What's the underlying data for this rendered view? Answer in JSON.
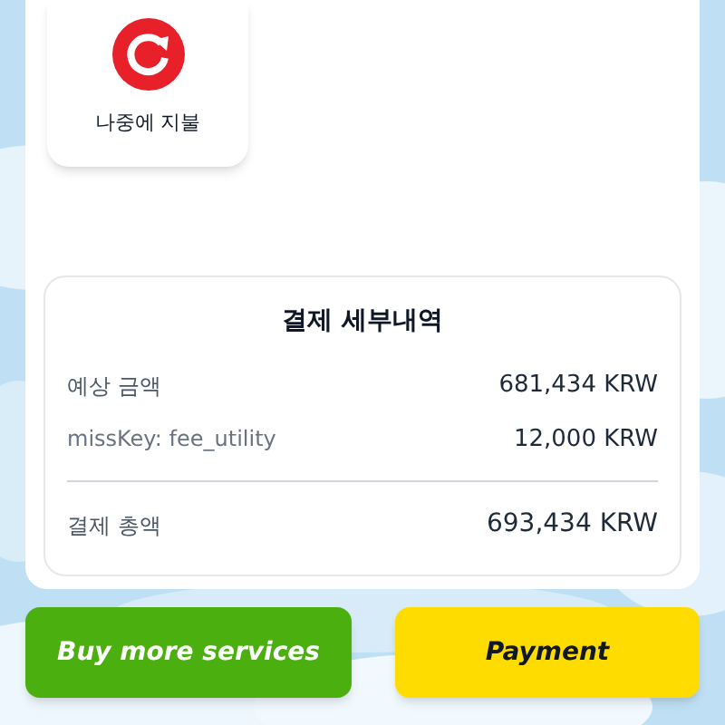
{
  "payment_options": [
    {
      "kind": "pay_later",
      "label": "나중에 지불"
    }
  ],
  "details": {
    "title": "결제 세부내역",
    "lines": [
      {
        "label": "예상 금액",
        "amount": "681,434 KRW",
        "kind": "item"
      },
      {
        "label": "missKey: fee_utility",
        "amount": "12,000 KRW",
        "kind": "fee"
      },
      {
        "label": "결제 총액",
        "amount": "693,434 KRW",
        "kind": "total"
      }
    ]
  },
  "buttons": [
    {
      "label": "Buy more services",
      "kind": "secondary"
    },
    {
      "label": "Payment",
      "kind": "primary"
    }
  ]
}
